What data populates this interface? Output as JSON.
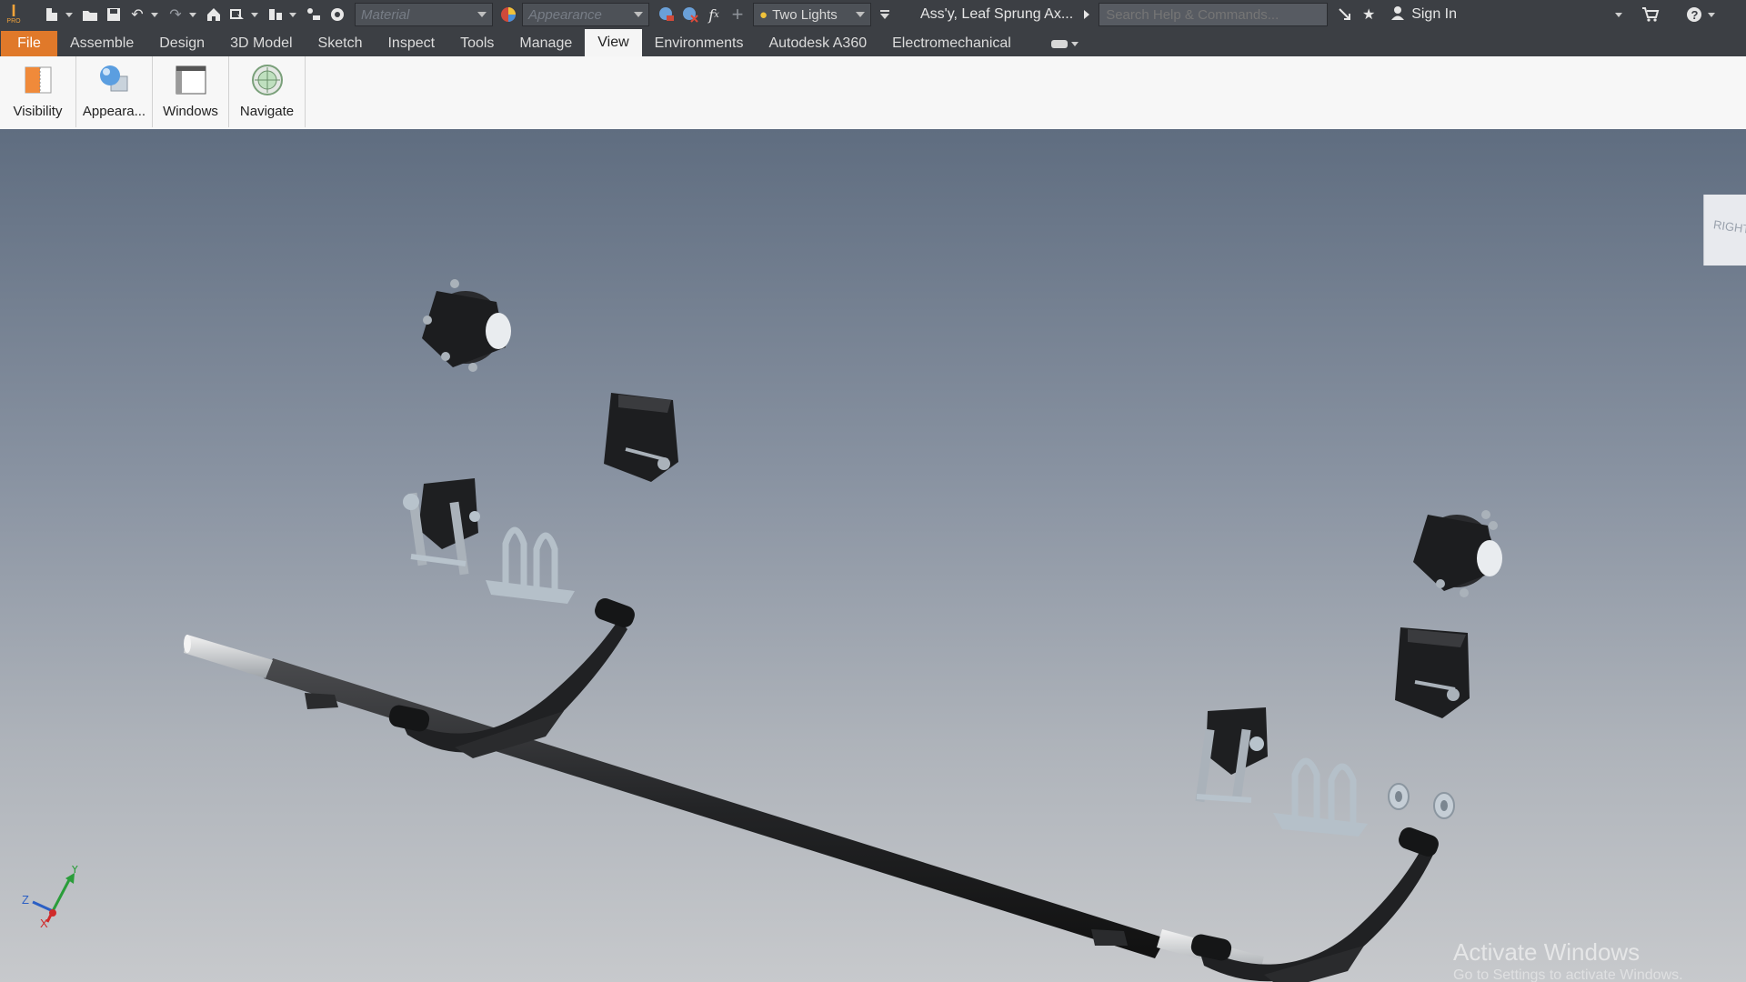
{
  "app": {
    "logo_letter": "I",
    "logo_sub": "PRO"
  },
  "qat": {
    "material_placeholder": "Material",
    "appearance_placeholder": "Appearance",
    "lights": "Two Lights",
    "doc_title": "Ass'y, Leaf Sprung Ax...",
    "search_placeholder": "Search Help & Commands...",
    "sign_in": "Sign In"
  },
  "tabs": [
    "File",
    "Assemble",
    "Design",
    "3D Model",
    "Sketch",
    "Inspect",
    "Tools",
    "Manage",
    "View",
    "Environments",
    "Autodesk A360",
    "Electromechanical"
  ],
  "active_tab": "View",
  "ribbon": {
    "visibility": "Visibility",
    "appearance": "Appeara...",
    "windows": "Windows",
    "navigate": "Navigate"
  },
  "viewcube": {
    "face": "RIGHT"
  },
  "triad": {
    "x": "X",
    "y": "Y",
    "z": "Z"
  },
  "watermark": {
    "title": "Activate Windows",
    "subtitle": "Go to Settings to activate Windows."
  },
  "colors": {
    "accent": "#e0792a",
    "part": "#2b2c2e",
    "hardware": "#b8c3cc"
  }
}
